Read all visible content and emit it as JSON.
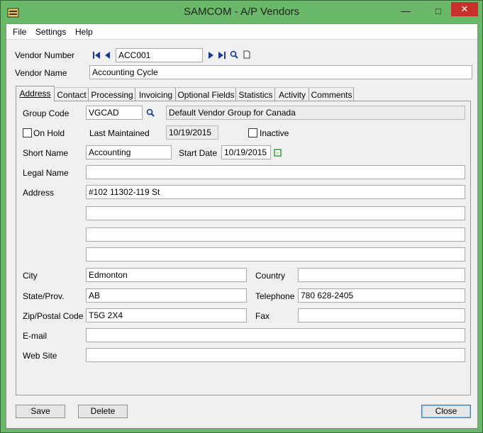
{
  "window": {
    "title": "SAMCOM - A/P Vendors"
  },
  "menu": {
    "items": [
      "File",
      "Settings",
      "Help"
    ]
  },
  "header": {
    "vendor_number_label": "Vendor Number",
    "vendor_number_value": "ACC001",
    "vendor_name_label": "Vendor Name",
    "vendor_name_value": "Accounting Cycle"
  },
  "tabs": [
    {
      "label": "Address",
      "active": true
    },
    {
      "label": "Contact"
    },
    {
      "label": "Processing"
    },
    {
      "label": "Invoicing"
    },
    {
      "label": "Optional Fields"
    },
    {
      "label": "Statistics"
    },
    {
      "label": "Activity"
    },
    {
      "label": "Comments"
    }
  ],
  "address": {
    "group_code_label": "Group Code",
    "group_code_value": "VGCAD",
    "group_description": "Default Vendor Group for Canada",
    "on_hold_label": "On Hold",
    "last_maintained_label": "Last Maintained",
    "last_maintained_value": "10/19/2015",
    "inactive_label": "Inactive",
    "short_name_label": "Short Name",
    "short_name_value": "Accounting",
    "start_date_label": "Start Date",
    "start_date_value": "10/19/2015",
    "legal_name_label": "Legal Name",
    "legal_name_value": "",
    "address_label": "Address",
    "address_lines": [
      "#102 11302-119 St",
      "",
      "",
      ""
    ],
    "city_label": "City",
    "city_value": "Edmonton",
    "country_label": "Country",
    "country_value": "",
    "state_label": "State/Prov.",
    "state_value": "AB",
    "telephone_label": "Telephone",
    "telephone_value": "780 628-2405",
    "zip_label": "Zip/Postal Code",
    "zip_value": "T5G 2X4",
    "fax_label": "Fax",
    "fax_value": "",
    "email_label": "E-mail",
    "email_value": "",
    "website_label": "Web Site",
    "website_value": ""
  },
  "buttons": {
    "save": "Save",
    "delete": "Delete",
    "close": "Close"
  },
  "colors": {
    "titlebar": "#6ab86a",
    "close": "#c7302b",
    "panel": "#f0f0f0"
  }
}
